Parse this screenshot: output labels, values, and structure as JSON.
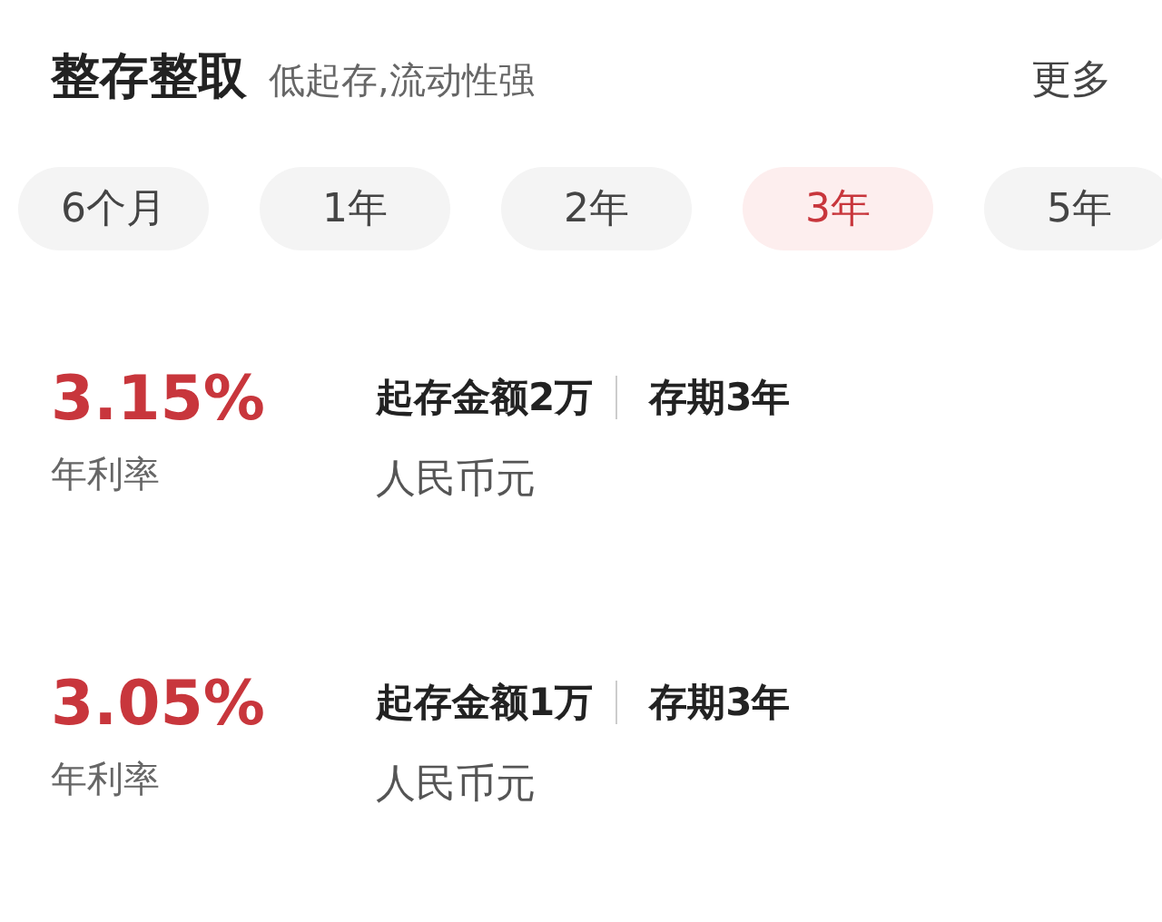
{
  "header": {
    "title": "整存整取",
    "subtitle": "低起存,流动性强",
    "more": "更多"
  },
  "tabs": [
    {
      "label": "6个月",
      "selected": false
    },
    {
      "label": "1年",
      "selected": false
    },
    {
      "label": "2年",
      "selected": false
    },
    {
      "label": "3年",
      "selected": true
    },
    {
      "label": "5年",
      "selected": false
    }
  ],
  "products": [
    {
      "rate": "3.15%",
      "rate_label": "年利率",
      "min_amount": "起存金额2万",
      "term": "存期3年",
      "currency": "人民币元"
    },
    {
      "rate": "3.05%",
      "rate_label": "年利率",
      "min_amount": "起存金额1万",
      "term": "存期3年",
      "currency": "人民币元"
    }
  ]
}
